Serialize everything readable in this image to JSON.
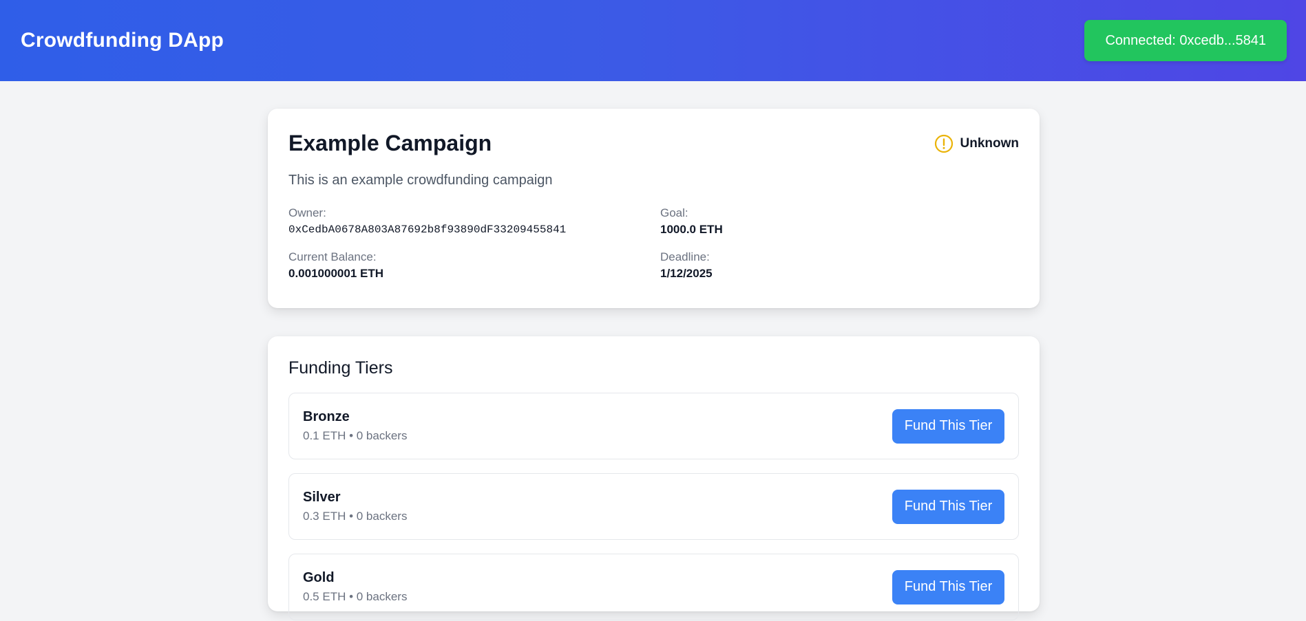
{
  "header": {
    "title": "Crowdfunding DApp",
    "connect_label": "Connected: 0xcedb...5841"
  },
  "campaign": {
    "title": "Example Campaign",
    "status": "Unknown",
    "status_icon": "exclamation-circle-icon",
    "description": "This is an example crowdfunding campaign",
    "owner_label": "Owner:",
    "owner_value": "0xCedbA0678A803A87692b8f93890dF33209455841",
    "goal_label": "Goal:",
    "goal_value": "1000.0 ETH",
    "balance_label": "Current Balance:",
    "balance_value": "0.001000001 ETH",
    "deadline_label": "Deadline:",
    "deadline_value": "1/12/2025"
  },
  "tiers": {
    "title": "Funding Tiers",
    "button_label": "Fund This Tier",
    "items": [
      {
        "name": "Bronze",
        "meta": "0.1 ETH • 0 backers"
      },
      {
        "name": "Silver",
        "meta": "0.3 ETH • 0 backers"
      },
      {
        "name": "Gold",
        "meta": "0.5 ETH • 0 backers"
      }
    ]
  },
  "colors": {
    "header_gradient_start": "#2f5ee8",
    "header_gradient_end": "#4f46e5",
    "connected_green": "#22c55e",
    "button_blue": "#3b82f6",
    "status_warning": "#eab308"
  }
}
